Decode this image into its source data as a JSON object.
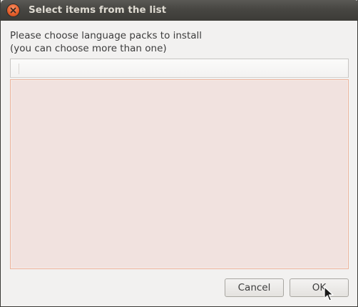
{
  "window": {
    "title": "Select items from the list"
  },
  "dialog": {
    "prompt_line1": "Please choose language packs to install",
    "prompt_line2": "(you can choose more than one)"
  },
  "list": {
    "columns": [
      ""
    ],
    "rows": []
  },
  "buttons": {
    "cancel_label": "Cancel",
    "ok_label": "OK"
  },
  "colors": {
    "titlebar": "#3c3b37",
    "close_button": "#e8602c",
    "list_background": "#f1e2df",
    "list_border": "#ecb39b"
  },
  "icons": {
    "close": "close-icon",
    "cursor": "mouse-pointer-icon"
  }
}
